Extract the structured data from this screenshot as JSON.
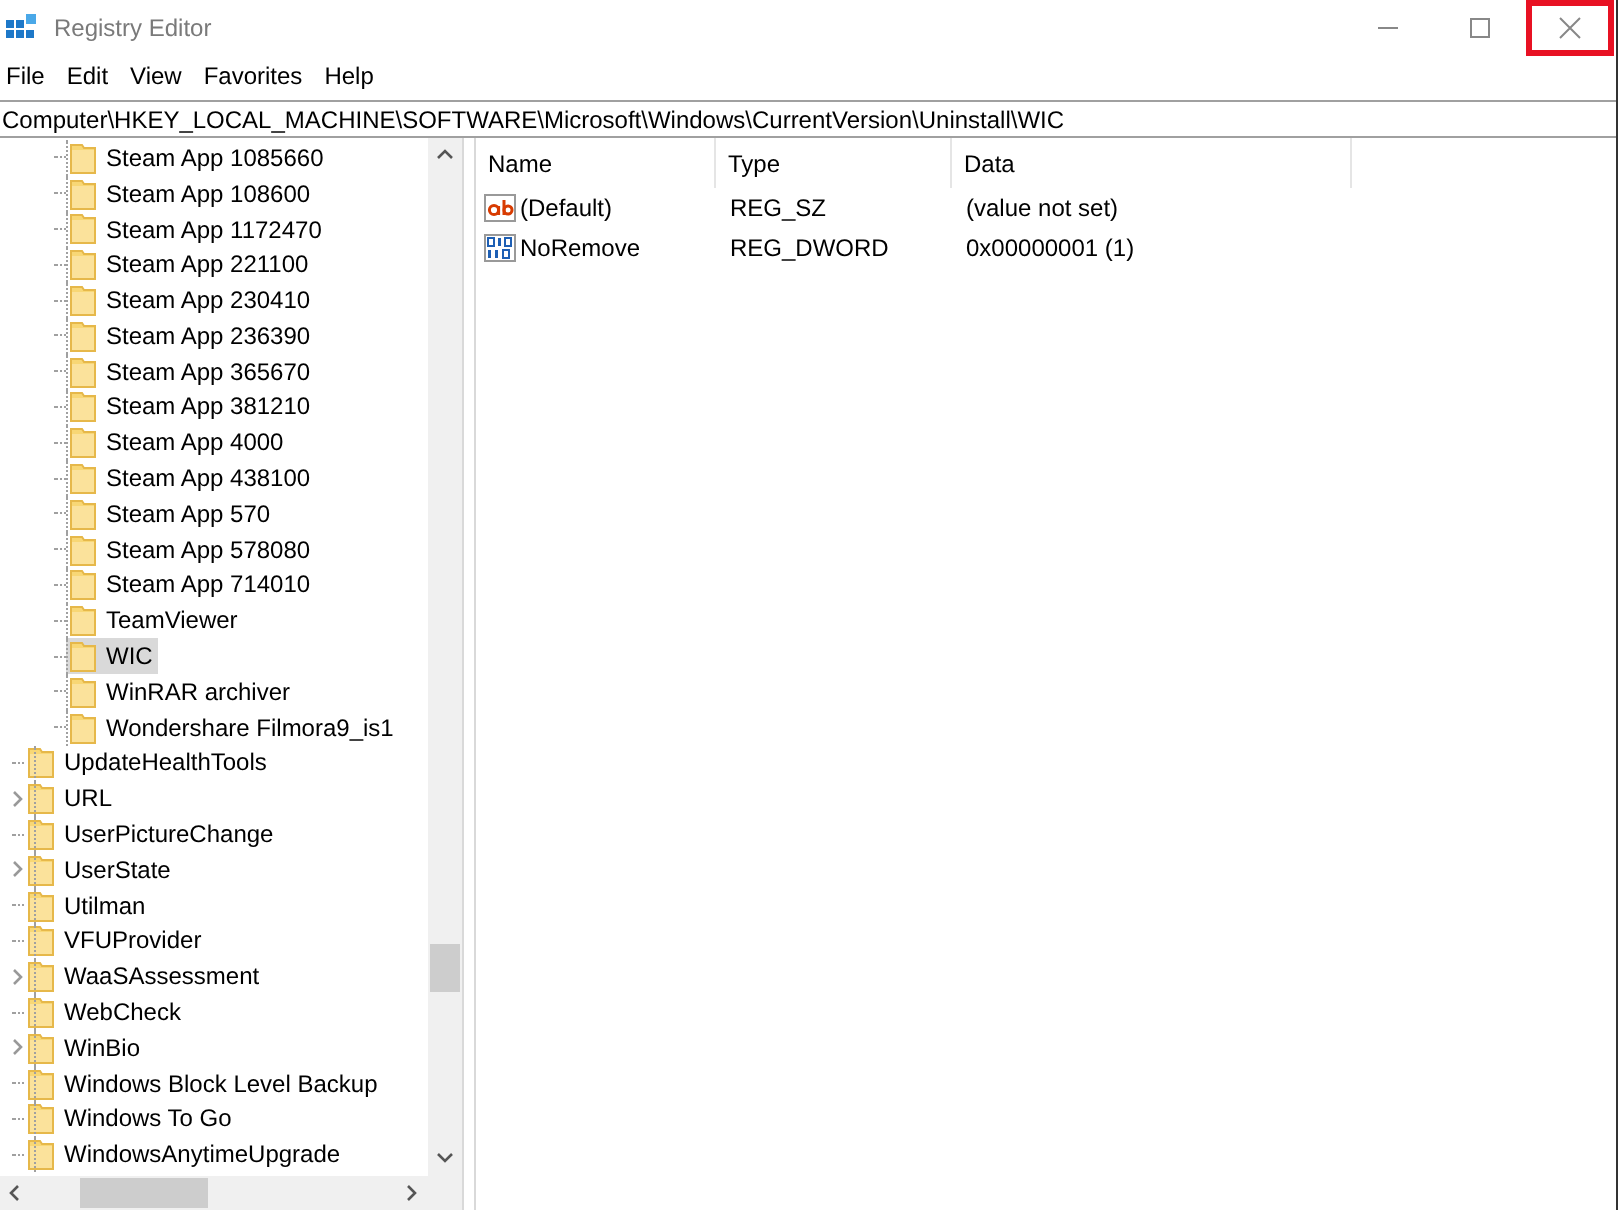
{
  "window": {
    "title": "Registry Editor",
    "close_highlighted": true
  },
  "menu": [
    "File",
    "Edit",
    "View",
    "Favorites",
    "Help"
  ],
  "address": "Computer\\HKEY_LOCAL_MACHINE\\SOFTWARE\\Microsoft\\Windows\\CurrentVersion\\Uninstall\\WIC",
  "tree": [
    {
      "children": [
        {
          "label": "Steam App 1085660",
          "selected": false
        },
        {
          "label": "Steam App 108600",
          "selected": false
        },
        {
          "label": "Steam App 1172470",
          "selected": false
        },
        {
          "label": "Steam App 221100",
          "selected": false
        },
        {
          "label": "Steam App 230410",
          "selected": false
        },
        {
          "label": "Steam App 236390",
          "selected": false
        },
        {
          "label": "Steam App 365670",
          "selected": false
        },
        {
          "label": "Steam App 381210",
          "selected": false
        },
        {
          "label": "Steam App 4000",
          "selected": false
        },
        {
          "label": "Steam App 438100",
          "selected": false
        },
        {
          "label": "Steam App 570",
          "selected": false
        },
        {
          "label": "Steam App 578080",
          "selected": false
        },
        {
          "label": "Steam App 714010",
          "selected": false
        },
        {
          "label": "TeamViewer",
          "selected": false
        },
        {
          "label": "WIC",
          "selected": true
        },
        {
          "label": "WinRAR archiver",
          "selected": false
        },
        {
          "label": "Wondershare Filmora9_is1",
          "selected": false
        }
      ]
    },
    {
      "label": "UpdateHealthTools",
      "selected": false,
      "expandable": false
    },
    {
      "label": "URL",
      "selected": false,
      "expandable": true
    },
    {
      "label": "UserPictureChange",
      "selected": false,
      "expandable": false
    },
    {
      "label": "UserState",
      "selected": false,
      "expandable": true
    },
    {
      "label": "Utilman",
      "selected": false,
      "expandable": false
    },
    {
      "label": "VFUProvider",
      "selected": false,
      "expandable": false
    },
    {
      "label": "WaaSAssessment",
      "selected": false,
      "expandable": true
    },
    {
      "label": "WebCheck",
      "selected": false,
      "expandable": false
    },
    {
      "label": "WinBio",
      "selected": false,
      "expandable": true
    },
    {
      "label": "Windows Block Level Backup",
      "selected": false,
      "expandable": false
    },
    {
      "label": "Windows To Go",
      "selected": false,
      "expandable": false
    },
    {
      "label": "WindowsAnytimeUpgrade",
      "selected": false,
      "expandable": false
    }
  ],
  "table": {
    "columns": [
      "Name",
      "Type",
      "Data"
    ],
    "rows": [
      {
        "kind": "string",
        "name": "(Default)",
        "type": "REG_SZ",
        "data": "(value not set)"
      },
      {
        "kind": "binary",
        "name": "NoRemove",
        "type": "REG_DWORD",
        "data": "0x00000001 (1)"
      }
    ]
  }
}
